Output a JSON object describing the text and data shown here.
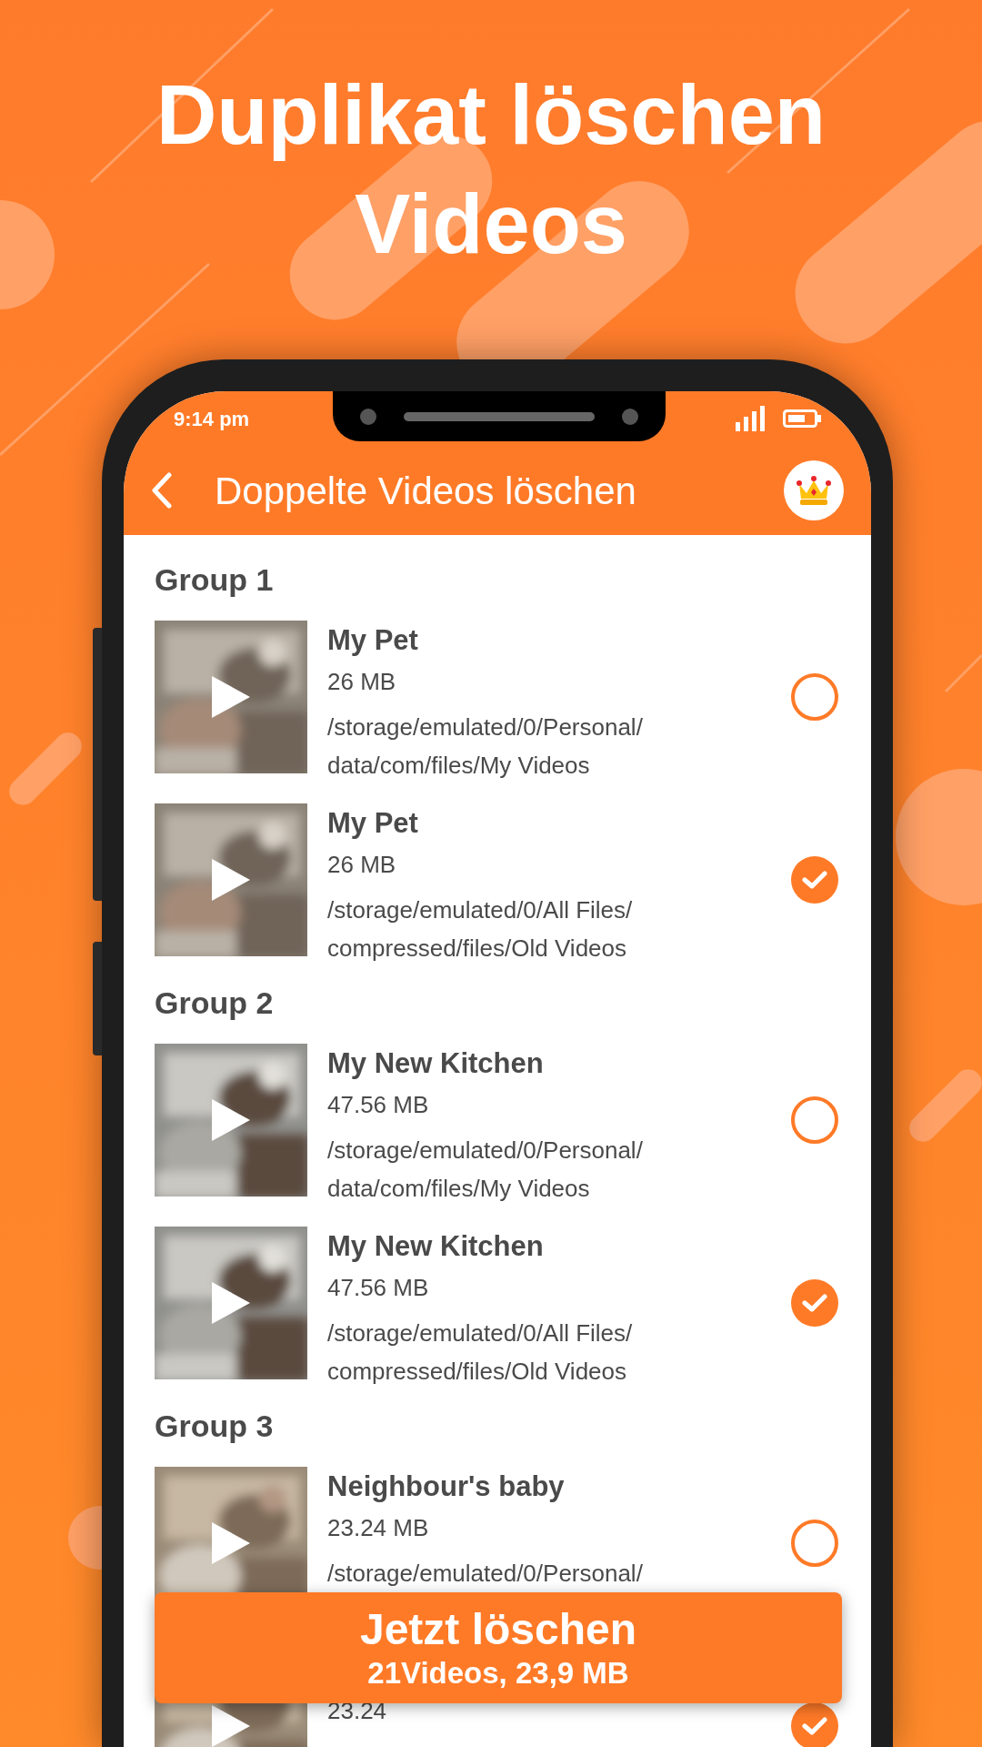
{
  "headline": [
    "Duplikat löschen",
    "Videos"
  ],
  "status_bar": {
    "time": "9:14 pm"
  },
  "app_bar": {
    "title": "Doppelte Videos löschen"
  },
  "groups": [
    {
      "label": "Group 1",
      "items": [
        {
          "name": "My Pet",
          "size": "26 MB",
          "path": [
            "/storage/emulated/0/Personal/",
            "data/com/files/My Videos"
          ],
          "selected": false
        },
        {
          "name": "My Pet",
          "size": "26 MB",
          "path": [
            "/storage/emulated/0/All Files/",
            "compressed/files/Old Videos"
          ],
          "selected": true
        }
      ]
    },
    {
      "label": "Group 2",
      "items": [
        {
          "name": "My New Kitchen",
          "size": "47.56 MB",
          "path": [
            "/storage/emulated/0/Personal/",
            "data/com/files/My Videos"
          ],
          "selected": false
        },
        {
          "name": "My New Kitchen",
          "size": "47.56 MB",
          "path": [
            "/storage/emulated/0/All Files/",
            "compressed/files/Old Videos"
          ],
          "selected": true
        }
      ]
    },
    {
      "label": "Group 3",
      "items": [
        {
          "name": "Neighbour's baby",
          "size": "23.24 MB",
          "path": [
            "/storage/emulated/0/Personal/"
          ],
          "selected": false
        },
        {
          "size": "23.24",
          "selected": true
        }
      ]
    }
  ],
  "delete_button": {
    "label": "Jetzt löschen",
    "summary": "21Videos, 23,9 MB"
  }
}
